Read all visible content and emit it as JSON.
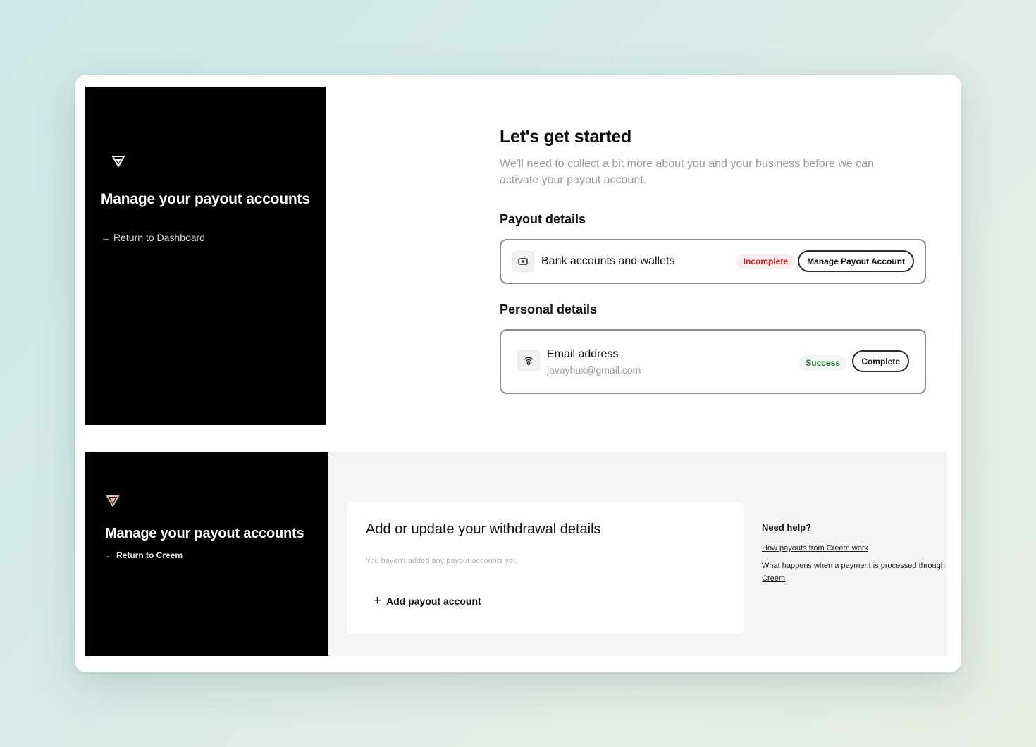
{
  "top": {
    "sidebar": {
      "logo_icon": "triangle-logo-icon",
      "title": "Manage your payout accounts",
      "back_arrow": "←",
      "back_label": "Return to Dashboard"
    },
    "main": {
      "heading": "Let's get started",
      "subtitle": "We'll need to collect a bit more about you and your business before we can activate your payout account.",
      "payout_section": {
        "title": "Payout details",
        "row": {
          "icon": "wallet-icon",
          "label": "Bank accounts and wallets",
          "status": "Incomplete",
          "status_color": "#d11c1c",
          "action": "Manage Payout Account"
        }
      },
      "personal_section": {
        "title": "Personal details",
        "row": {
          "icon": "fingerprint-icon",
          "label": "Email address",
          "value": "javayhux@gmail.com",
          "status": "Success",
          "status_color": "#1f7a33",
          "action": "Complete"
        }
      }
    }
  },
  "bottom": {
    "sidebar": {
      "logo_icon": "triangle-logo-icon",
      "logo_color": "#e8b49a",
      "title": "Manage your payout accounts",
      "back_arrow": "←",
      "back_label": "Return to Creem"
    },
    "panel": {
      "title": "Add or update your withdrawal details",
      "empty_text": "You haven't added any payout accounts yet.",
      "add_symbol": "+",
      "add_label": "Add payout account"
    },
    "help": {
      "title": "Need help?",
      "links": [
        "How payouts from Creem work",
        "What happens when a payment is processed through Creem"
      ]
    }
  }
}
